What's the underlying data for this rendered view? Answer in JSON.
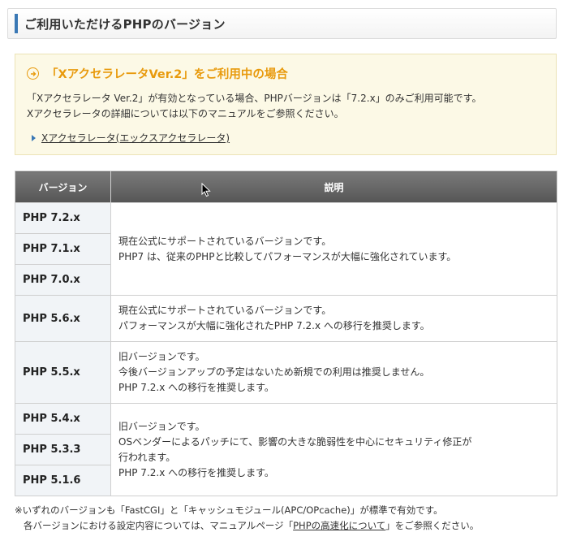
{
  "section": {
    "title": "ご利用いただけるPHPのバージョン"
  },
  "notice": {
    "title": "「XアクセラレータVer.2」をご利用中の場合",
    "line1": "「Xアクセラレータ Ver.2」が有効となっている場合、PHPバージョンは「7.2.x」のみご利用可能です。",
    "line2": "Xアクセラレータの詳細については以下のマニュアルをご参照ください。",
    "link": "Xアクセラレータ(エックスアクセラレータ)"
  },
  "table": {
    "headers": [
      "バージョン",
      "説明"
    ],
    "groups": [
      {
        "versions": [
          "PHP 7.2.x",
          "PHP 7.1.x",
          "PHP 7.0.x"
        ],
        "desc": [
          "現在公式にサポートされているバージョンです。",
          "PHP7 は、従来のPHPと比較してパフォーマンスが大幅に強化されています。"
        ]
      },
      {
        "versions": [
          "PHP 5.6.x"
        ],
        "desc": [
          "現在公式にサポートされているバージョンです。",
          "パフォーマンスが大幅に強化されたPHP 7.2.x への移行を推奨します。"
        ]
      },
      {
        "versions": [
          "PHP 5.5.x"
        ],
        "desc": [
          "旧バージョンです。",
          "今後バージョンアップの予定はないため新規での利用は推奨しません。",
          "PHP 7.2.x への移行を推奨します。"
        ]
      },
      {
        "versions": [
          "PHP 5.4.x",
          "PHP 5.3.3",
          "PHP 5.1.6"
        ],
        "desc": [
          "旧バージョンです。",
          "OSベンダーによるパッチにて、影響の大きな脆弱性を中心にセキュリティ修正が",
          "行われます。",
          "PHP 7.2.x への移行を推奨します。"
        ]
      }
    ]
  },
  "footnote": {
    "line1": "※いずれのバージョンも「FastCGI」と「キャッシュモジュール(APC/OPcache)」が標準で有効です。",
    "line2_pre": "各バージョンにおける設定内容については、マニュアルページ「",
    "line2_link": "PHPの高速化について",
    "line2_post": "」をご参照ください。"
  },
  "colors": {
    "accent_blue": "#3a78b5",
    "notice_orange": "#e89a0c",
    "header_gray": "#666666"
  }
}
